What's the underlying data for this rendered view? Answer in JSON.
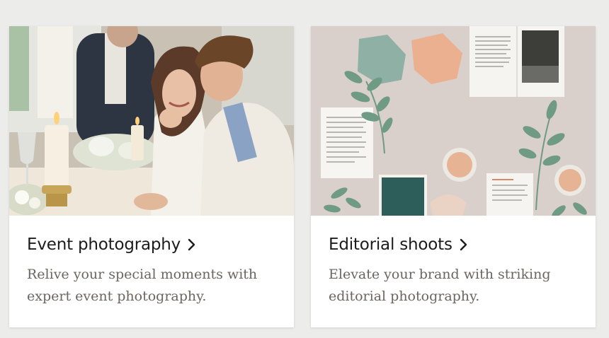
{
  "cards": [
    {
      "title": "Event photography",
      "description": "Relive your special moments with expert event photography.",
      "image_alt": "Smiling couple at a candle-lit wedding table"
    },
    {
      "title": "Editorial shoots",
      "description": "Elevate your brand with striking editorial photography.",
      "image_alt": "Flat-lay of magazines, paint swatches and eucalyptus leaves"
    }
  ],
  "colors": {
    "page_background": "#ececea",
    "card_background": "#ffffff",
    "title_text": "#1c1c1c",
    "description_text": "#6b6560",
    "swatch_sage": "#8fb0a4",
    "swatch_peach": "#eab08f",
    "swatch_teal": "#2e5e5a"
  },
  "icons": {
    "title_chevron": "chevron-right-icon"
  }
}
